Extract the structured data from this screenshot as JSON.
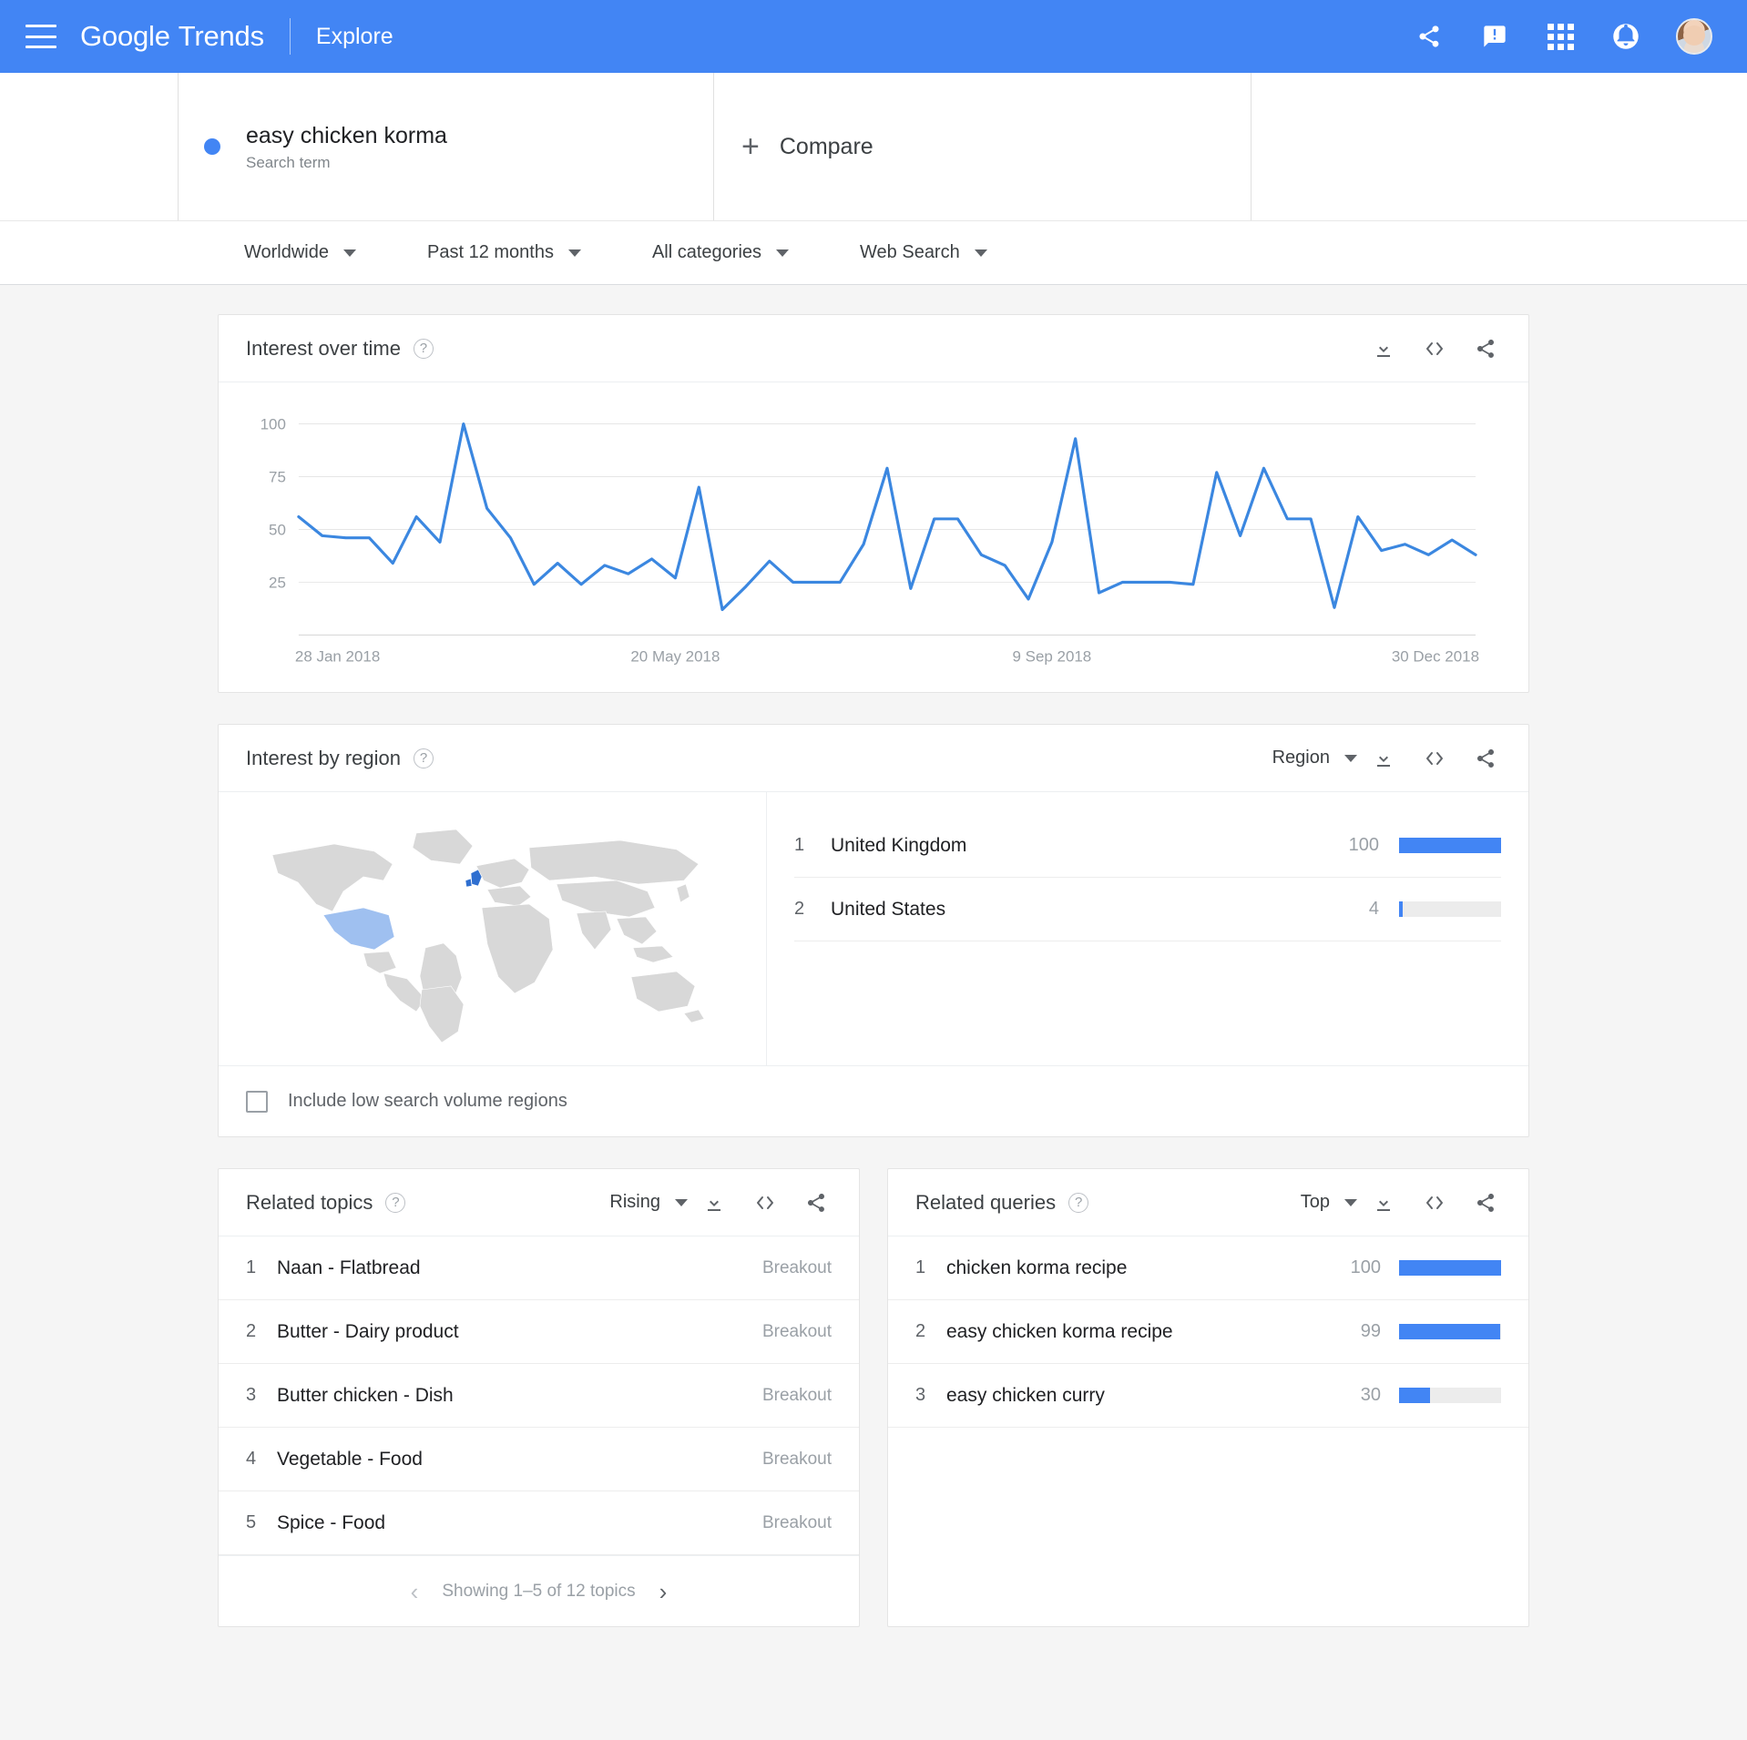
{
  "header": {
    "brand_google": "Google",
    "brand_trends": "Trends",
    "explore": "Explore",
    "icons": [
      "share-icon",
      "feedback-icon",
      "apps-grid-icon",
      "notifications-icon",
      "avatar"
    ]
  },
  "search": {
    "term": "easy chicken korma",
    "type": "Search term",
    "compare_label": "Compare",
    "compare_plus": "+"
  },
  "filters": [
    {
      "label": "Worldwide",
      "name": "location"
    },
    {
      "label": "Past 12 months",
      "name": "time-range"
    },
    {
      "label": "All categories",
      "name": "category"
    },
    {
      "label": "Web Search",
      "name": "search-type"
    }
  ],
  "interest_over_time": {
    "title": "Interest over time",
    "help": "?"
  },
  "interest_by_region": {
    "title": "Interest by region",
    "help": "?",
    "scope_label": "Region",
    "checkbox_label": "Include low search volume regions",
    "rows": [
      {
        "rank": "1",
        "name": "United Kingdom",
        "value": "100",
        "pct": 100
      },
      {
        "rank": "2",
        "name": "United States",
        "value": "4",
        "pct": 4
      }
    ]
  },
  "related_topics": {
    "title": "Related topics",
    "help": "?",
    "sort_label": "Rising",
    "rows": [
      {
        "rank": "1",
        "name": "Naan - Flatbread",
        "value": "Breakout"
      },
      {
        "rank": "2",
        "name": "Butter - Dairy product",
        "value": "Breakout"
      },
      {
        "rank": "3",
        "name": "Butter chicken - Dish",
        "value": "Breakout"
      },
      {
        "rank": "4",
        "name": "Vegetable - Food",
        "value": "Breakout"
      },
      {
        "rank": "5",
        "name": "Spice - Food",
        "value": "Breakout"
      }
    ],
    "pager_text": "Showing 1–5 of 12 topics",
    "prev": "‹",
    "next": "›"
  },
  "related_queries": {
    "title": "Related queries",
    "help": "?",
    "sort_label": "Top",
    "rows": [
      {
        "rank": "1",
        "name": "chicken korma recipe",
        "value": "100",
        "pct": 100
      },
      {
        "rank": "2",
        "name": "easy chicken korma recipe",
        "value": "99",
        "pct": 99
      },
      {
        "rank": "3",
        "name": "easy chicken curry",
        "value": "30",
        "pct": 30
      }
    ]
  },
  "colors": {
    "accent": "#4285f4",
    "line": "#3b87e0",
    "bar_track": "#ececec",
    "map_land": "#d8d8d8",
    "map_high": "#2f6fd0",
    "map_low": "#9fc0f0"
  },
  "chart_data": {
    "type": "line",
    "title": "Interest over time",
    "xlabel": "",
    "ylabel": "",
    "ylim": [
      0,
      100
    ],
    "yticks": [
      25,
      50,
      75,
      100
    ],
    "ytick_labels": [
      "25",
      "50",
      "75",
      "100"
    ],
    "grid": true,
    "legend": [
      "easy chicken korma"
    ],
    "x_tick_labels": [
      "28 Jan 2018",
      "20 May 2018",
      "9 Sep 2018",
      "30 Dec 2018"
    ],
    "x_tick_positions": [
      0,
      16,
      32,
      48
    ],
    "series": [
      {
        "name": "easy chicken korma",
        "color": "#3b87e0",
        "values": [
          56,
          47,
          46,
          46,
          34,
          56,
          44,
          100,
          60,
          46,
          24,
          34,
          24,
          33,
          29,
          36,
          27,
          70,
          12,
          23,
          35,
          25,
          25,
          25,
          43,
          79,
          22,
          55,
          55,
          38,
          33,
          17,
          44,
          93,
          20,
          25,
          25,
          25,
          24,
          77,
          47,
          79,
          55,
          55,
          13,
          56,
          40,
          43,
          38,
          45,
          38
        ]
      }
    ]
  }
}
